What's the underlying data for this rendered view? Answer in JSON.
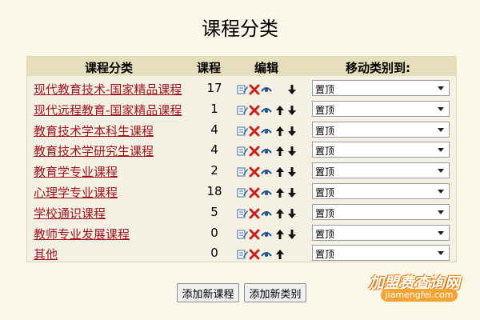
{
  "page": {
    "title": "课程分类"
  },
  "table": {
    "headers": {
      "name": "课程分类",
      "count": "课程",
      "edit": "编辑",
      "move": "移动类别到:"
    },
    "rows": [
      {
        "name": "现代教育技术-国家精品课程",
        "count": "17",
        "move_value": "置顶",
        "up": false,
        "down": true
      },
      {
        "name": "现代远程教育-国家精品课程",
        "count": "1",
        "move_value": "置顶",
        "up": true,
        "down": true
      },
      {
        "name": "教育技术学本科生课程",
        "count": "4",
        "move_value": "置顶",
        "up": true,
        "down": true
      },
      {
        "name": "教育技术学研究生课程",
        "count": "4",
        "move_value": "置顶",
        "up": true,
        "down": true
      },
      {
        "name": "教育学专业课程",
        "count": "2",
        "move_value": "置顶",
        "up": true,
        "down": true
      },
      {
        "name": "心理学专业课程",
        "count": "18",
        "move_value": "置顶",
        "up": true,
        "down": true
      },
      {
        "name": "学校通识课程",
        "count": "5",
        "move_value": "置顶",
        "up": true,
        "down": true
      },
      {
        "name": "教师专业发展课程",
        "count": "0",
        "move_value": "置顶",
        "up": true,
        "down": true
      },
      {
        "name": "其他",
        "count": "0",
        "move_value": "置顶",
        "up": true,
        "down": false
      }
    ],
    "icons": {
      "edit": "edit-icon",
      "delete": "delete-icon",
      "hide": "eye-icon",
      "up": "arrow-up-icon",
      "down": "arrow-down-icon"
    }
  },
  "buttons": {
    "add_course": "添加新课程",
    "add_category": "添加新类别"
  },
  "watermark": {
    "main": "加盟费查询网",
    "sub": "jiamengfei.com"
  },
  "colors": {
    "link": "#a0151e",
    "header_bg": "#e6ddbc",
    "page_bg": "#fbf8ea"
  }
}
